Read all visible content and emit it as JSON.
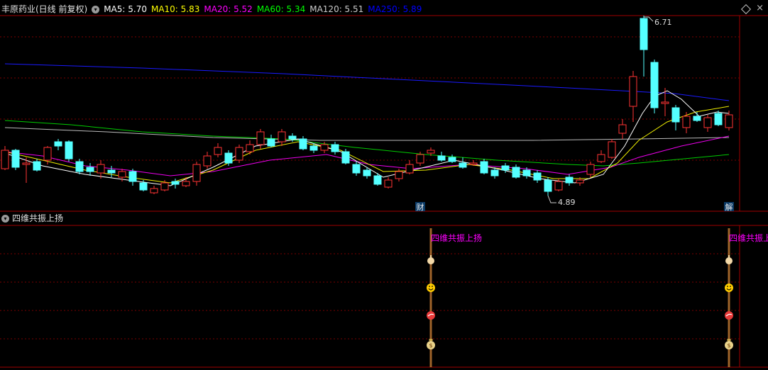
{
  "header": {
    "stock": "丰原药业(日线 前复权)",
    "ma": [
      {
        "label": "MA5: 5.70",
        "color": "#ffffff"
      },
      {
        "label": "MA10: 5.83",
        "color": "#ffff00"
      },
      {
        "label": "MA20: 5.52",
        "color": "#ff00ff"
      },
      {
        "label": "MA60: 5.34",
        "color": "#00ff00"
      },
      {
        "label": "MA120: 5.51",
        "color": "#cccccc"
      },
      {
        "label": "MA250: 5.89",
        "color": "#0000ff"
      }
    ]
  },
  "price_chart": {
    "high_label": "6.71",
    "low_label": "4.89",
    "markers": [
      "财",
      "解"
    ],
    "colors": {
      "up": "#ff3333",
      "down": "#54ffff",
      "grid": "#7a0000",
      "border": "#a00000"
    }
  },
  "indicator": {
    "title": "四维共振上扬",
    "signal_text": "四维共振上扬",
    "signal_color": "#ff00ff",
    "bar_color": "#a0642a"
  }
}
